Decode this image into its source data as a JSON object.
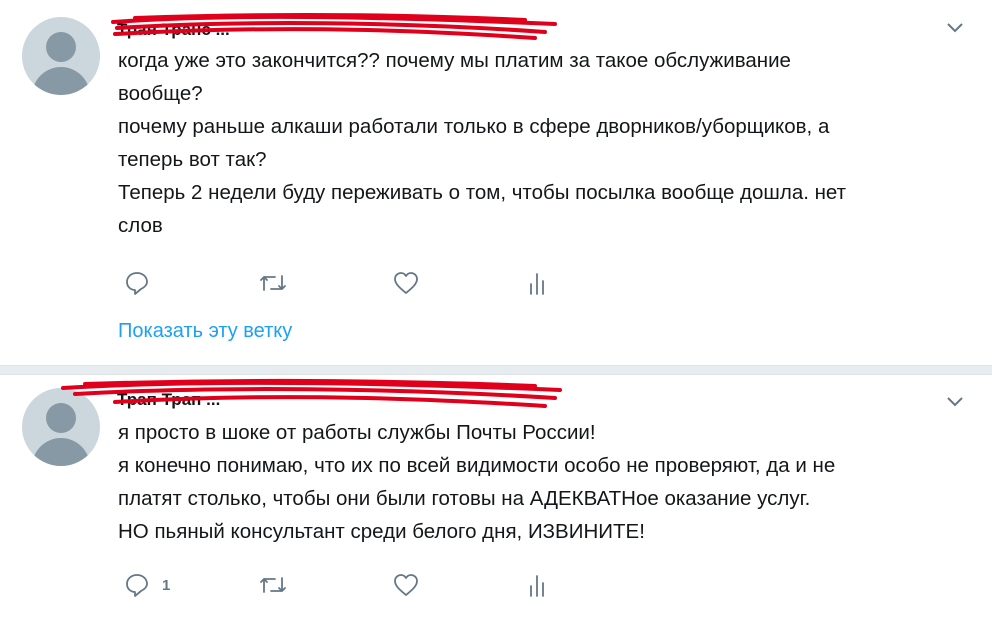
{
  "tweets": [
    {
      "author": "Тран Транс ...",
      "lines": [
        "когда уже это закончится?? почему мы платим за такое обслуживание",
        "вообще?",
        "почему раньше алкаши работали только в сфере дворников/уборщиков, а",
        "теперь вот так?",
        "Теперь 2 недели буду переживать о том, чтобы посылка вообще дошла. нет",
        "слов"
      ],
      "actions": {
        "reply_count": "",
        "retweet_count": "",
        "like_count": ""
      },
      "show_thread": "Показать эту ветку"
    },
    {
      "author": "Трап Трап ...",
      "lines": [
        "я просто в шоке от работы службы Почты России!",
        "я конечно понимаю, что их по всей видимости особо не проверяют, да и не",
        "платят столько, чтобы они были готовы на АДЕКВАТНое оказание услуг.",
        "НО пьяный консультант среди белого дня, ИЗВИНИТЕ!"
      ],
      "actions": {
        "reply_count": "1",
        "retweet_count": "",
        "like_count": ""
      }
    }
  ],
  "icons": {
    "reply": "reply-icon",
    "retweet": "retweet-icon",
    "like": "heart-icon",
    "analytics": "analytics-icon",
    "more": "chevron-down-icon"
  },
  "colors": {
    "link": "#1da1f2",
    "icon": "#657786",
    "redaction": "#e0001b",
    "divider": "#e6ecf0"
  }
}
